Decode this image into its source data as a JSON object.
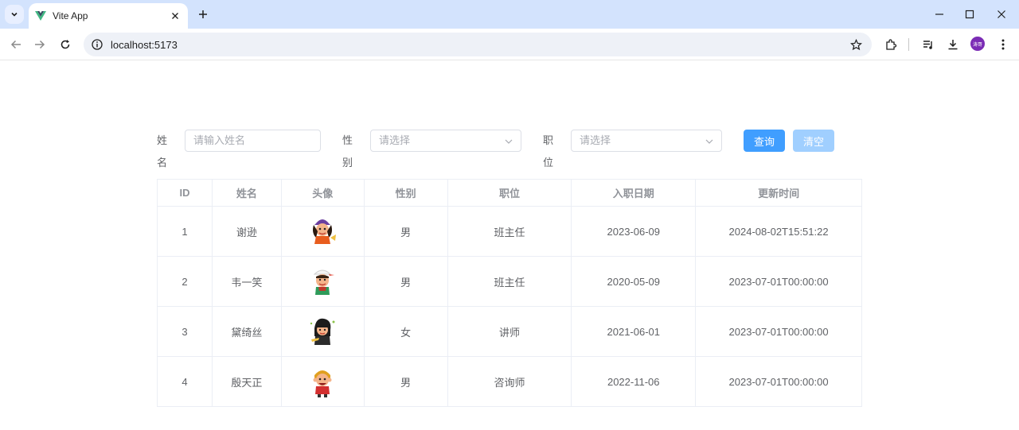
{
  "browser": {
    "tab_title": "Vite App",
    "url": "localhost:5173",
    "profile_initials": "涛哥"
  },
  "search": {
    "name_label": "姓名",
    "name_placeholder": "请输入姓名",
    "gender_label": "性别",
    "gender_placeholder": "请选择",
    "job_label": "职位",
    "job_placeholder": "请选择",
    "query_button": "查询",
    "clear_button": "清空"
  },
  "table": {
    "headers": [
      "ID",
      "姓名",
      "头像",
      "性别",
      "职位",
      "入职日期",
      "更新时间"
    ],
    "rows": [
      {
        "id": "1",
        "name": "谢逊",
        "gender": "男",
        "job": "班主任",
        "entry_date": "2023-06-09",
        "update_time": "2024-08-02T15:51:22",
        "avatar": "purple-cap-avatar-icon"
      },
      {
        "id": "2",
        "name": "韦一笑",
        "gender": "男",
        "job": "班主任",
        "entry_date": "2020-05-09",
        "update_time": "2023-07-01T00:00:00",
        "avatar": "white-cap-avatar-icon"
      },
      {
        "id": "3",
        "name": "黛绮丝",
        "gender": "女",
        "job": "讲师",
        "entry_date": "2021-06-01",
        "update_time": "2023-07-01T00:00:00",
        "avatar": "black-hair-avatar-icon"
      },
      {
        "id": "4",
        "name": "殷天正",
        "gender": "男",
        "job": "咨询师",
        "entry_date": "2022-11-06",
        "update_time": "2023-07-01T00:00:00",
        "avatar": "red-shirt-avatar-icon"
      }
    ]
  },
  "colors": {
    "primary": "#409eff",
    "primary_light": "#a0cfff",
    "tab_strip": "#d3e3fd"
  }
}
